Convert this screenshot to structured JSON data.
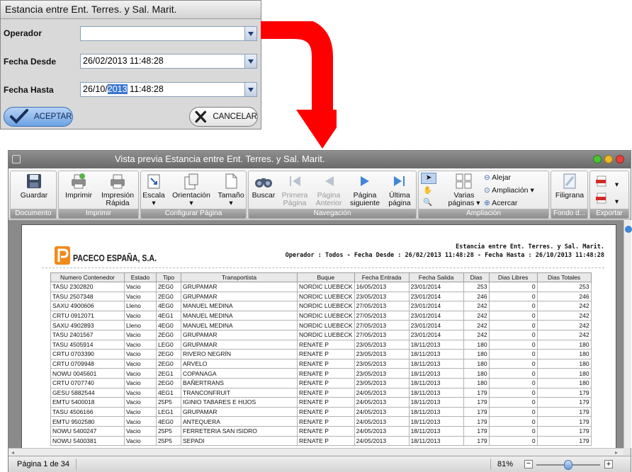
{
  "dialog": {
    "title": "Estancia entre Ent. Terres. y Sal. Marit.",
    "operador_label": "Operador",
    "operador_value": "",
    "fecha_desde_label": "Fecha Desde",
    "fecha_desde_value": "26/02/2013 11:48:28",
    "fecha_hasta_label": "Fecha Hasta",
    "fecha_hasta_prefix": "26/10/",
    "fecha_hasta_selected": "2013",
    "fecha_hasta_suffix": " 11:48:28",
    "accept_label": "ACEPTAR",
    "cancel_label": "CANCELAR"
  },
  "window": {
    "title": "Vista previa Estancia entre Ent. Terres. y Sal. Marit."
  },
  "ribbon": {
    "guardar": "Guardar",
    "imprimir": "Imprimir",
    "impresion_rapida_1": "Impresión",
    "impresion_rapida_2": "Rápida",
    "escala": "Escala",
    "orientacion": "Orientación",
    "tamano": "Tamaño",
    "buscar": "Buscar",
    "primera_1": "Primera",
    "primera_2": "Página",
    "anterior_1": "Página",
    "anterior_2": "Anterior",
    "siguiente_1": "Página",
    "siguiente_2": "siguiente",
    "ultima_1": "Última",
    "ultima_2": "página",
    "varias_1": "Varias",
    "varias_2": "páginas",
    "alejar": "Alejar",
    "ampliacion": "Ampliación",
    "acercar": "Acercar",
    "filigrana": "Filigrana",
    "groups": {
      "documento": "Documento",
      "imprimir": "Imprimir",
      "configurar": "Configurar Página",
      "navegacion": "Navegación",
      "ampliacion": "Ampliación",
      "fondo": "Fondo d...",
      "exportar": "Exportar"
    }
  },
  "report": {
    "title": "Estancia entre Ent. Terres. y Sal. Marit.",
    "subtitle": "Operador : Todos - Fecha Desde : 26/02/2013 11:48:28 - Fecha Hasta : 26/10/2013 11:48:28",
    "company": "PACECO ESPAÑA, S.A.",
    "columns": [
      "Numero Contenedor",
      "Estado",
      "Tipo",
      "Transportista",
      "Buque",
      "Fecha Entrada",
      "Fecha Salida",
      "Dias",
      "Dias Libres",
      "Dias Totales"
    ],
    "rows": [
      [
        "TASU 2302820",
        "Vacio",
        "2EG0",
        "GRUPAMAR",
        "NORDIC LUEBECK",
        "16/05/2013",
        "23/01/2014",
        "253",
        "0",
        "253"
      ],
      [
        "TASU 2507348",
        "Vacio",
        "2EG0",
        "GRUPAMAR",
        "NORDIC LUEBECK",
        "23/05/2013",
        "23/01/2014",
        "246",
        "0",
        "246"
      ],
      [
        "SAXU 4900606",
        "Lleno",
        "4EG0",
        "MANUEL MEDINA",
        "NORDIC LUEBECK",
        "27/05/2013",
        "23/01/2014",
        "242",
        "0",
        "242"
      ],
      [
        "CRTU 0912071",
        "Vacio",
        "4EG1",
        "MANUEL MEDINA",
        "NORDIC LUEBECK",
        "27/05/2013",
        "23/01/2014",
        "242",
        "0",
        "242"
      ],
      [
        "SAXU 4902893",
        "Lleno",
        "4EG0",
        "MANUEL MEDINA",
        "NORDIC LUEBECK",
        "27/05/2013",
        "23/01/2014",
        "242",
        "0",
        "242"
      ],
      [
        "TASU 2401567",
        "Vacio",
        "2EG0",
        "GRUPAMAR",
        "NORDIC LUEBECK",
        "27/05/2013",
        "23/01/2014",
        "242",
        "0",
        "242"
      ],
      [
        "TASU 4505914",
        "Vacio",
        "LEG0",
        "GRUPAMAR",
        "RENATE P",
        "23/05/2013",
        "18/11/2013",
        "180",
        "0",
        "180"
      ],
      [
        "CRTU 0703390",
        "Vacio",
        "2EG0",
        "RIVERO NEGRÍN",
        "RENATE P",
        "23/05/2013",
        "18/11/2013",
        "180",
        "0",
        "180"
      ],
      [
        "CRTU 0709948",
        "Vacio",
        "2EG0",
        "ARVELO",
        "RENATE P",
        "23/05/2013",
        "18/11/2013",
        "180",
        "0",
        "180"
      ],
      [
        "NOWU 0045601",
        "Vacio",
        "2EG1",
        "COPANAGA",
        "RENATE P",
        "23/05/2013",
        "18/11/2013",
        "180",
        "0",
        "180"
      ],
      [
        "CRTU 0707740",
        "Vacio",
        "2EG0",
        "BAÑERTRANS",
        "RENATE P",
        "23/05/2013",
        "18/11/2013",
        "180",
        "0",
        "180"
      ],
      [
        "GESU 5882544",
        "Vacio",
        "4EG1",
        "TRANCONFRUIT",
        "RENATE P",
        "24/05/2013",
        "18/11/2013",
        "179",
        "0",
        "179"
      ],
      [
        "EMTU 5400018",
        "Vacio",
        "25P5",
        "IGINIO TABARES E HIJOS",
        "RENATE P",
        "24/05/2013",
        "18/11/2013",
        "179",
        "0",
        "179"
      ],
      [
        "TASU 4506166",
        "Vacio",
        "LEG1",
        "GRUPAMAR",
        "RENATE P",
        "24/05/2013",
        "18/11/2013",
        "179",
        "0",
        "179"
      ],
      [
        "EMTU 9502580",
        "Vacio",
        "4EG0",
        "ANTEQUERA",
        "RENATE P",
        "24/05/2013",
        "18/11/2013",
        "179",
        "0",
        "179"
      ],
      [
        "NOWU 5400247",
        "Vacio",
        "25P5",
        "FERRETERIA SAN ISIDRO",
        "RENATE P",
        "24/05/2013",
        "18/11/2013",
        "179",
        "0",
        "179"
      ],
      [
        "NOWU 5400381",
        "Vacio",
        "25P5",
        "SEPADI",
        "RENATE P",
        "24/05/2013",
        "18/11/2013",
        "179",
        "0",
        "179"
      ]
    ]
  },
  "status": {
    "page_text": "Página 1 de 34",
    "zoom": "81%",
    "zoom_fraction": 0.5
  },
  "colors": {
    "arrow": "#ff0000",
    "accept_button": "#8cb8ee",
    "titlebar": "#7a7a7a"
  }
}
